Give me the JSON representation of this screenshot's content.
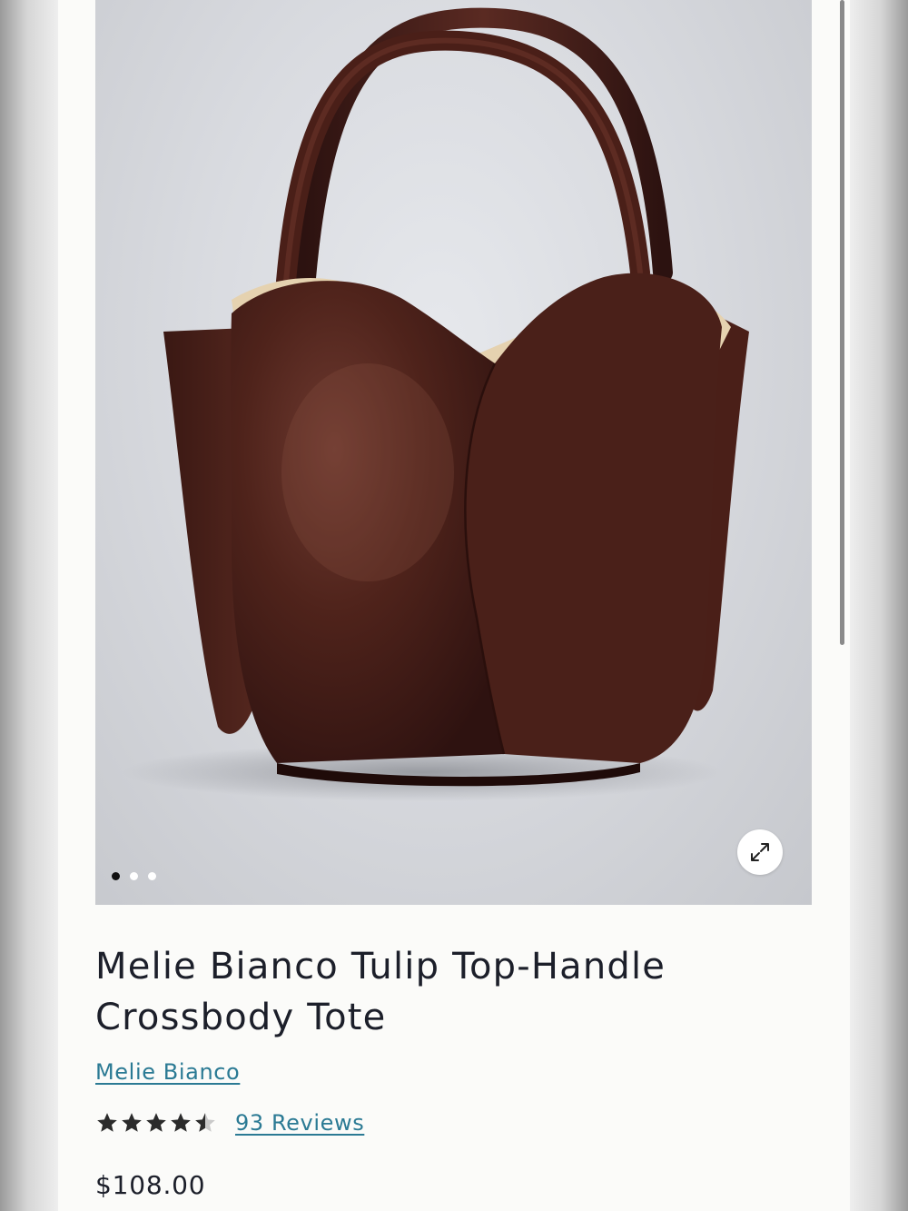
{
  "product": {
    "title": "Melie Bianco Tulip Top-Handle Crossbody Tote",
    "brand": "Melie Bianco",
    "rating_value": 4.5,
    "rating_max": 5,
    "reviews_label": "93 Reviews",
    "price": "$108.00"
  },
  "gallery": {
    "image_count": 3,
    "active_index": 0,
    "expand_icon": "expand-arrows-icon"
  },
  "colors": {
    "link": "#2b7a94",
    "text": "#1c1f2a",
    "bag_leather": "#4a2019",
    "bag_lining": "#e5d2b0"
  }
}
